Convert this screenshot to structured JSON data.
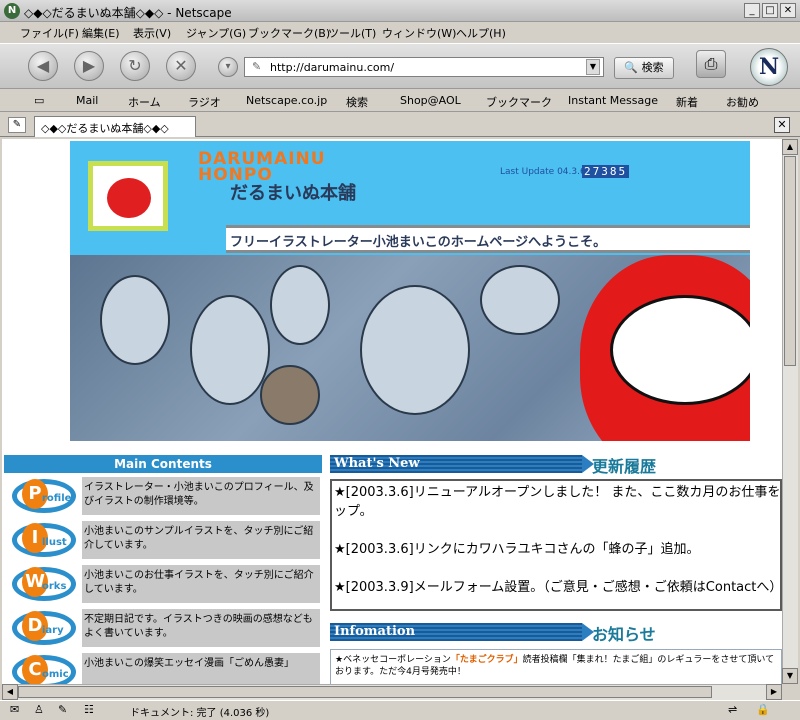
{
  "window": {
    "title": "◇◆◇だるまいぬ本舗◇◆◇ - Netscape",
    "min": "_",
    "max": "□",
    "close": "✕"
  },
  "menu": [
    "ファイル(F)",
    "編集(E)",
    "表示(V)",
    "ジャンプ(G)",
    "ブックマーク(B)",
    "ツール(T)",
    "ウィンドウ(W)",
    "ヘルプ(H)"
  ],
  "nav": {
    "url": "http://darumainu.com/",
    "search_label": "🔍 検索"
  },
  "personal_toolbar": [
    "Mail",
    "ホーム",
    "ラジオ",
    "Netscape.co.jp",
    "検索",
    "Shop@AOL",
    "ブックマーク",
    "Instant Message",
    "新着",
    "お勧め"
  ],
  "tab": {
    "label": "◇◆◇だるまいぬ本舗◇◆◇"
  },
  "status": {
    "text": "ドキュメント: 完了 (4.036 秒)"
  },
  "banner": {
    "logo_en": "DARUMAINU\nHONPO",
    "logo_jp": "だるまいぬ本舗",
    "last_update": "Last Update 04.3.6",
    "counter": "27385",
    "welcome": "フリーイラストレーター小池まいこのホームページへようこそ。"
  },
  "main_contents": {
    "heading": "Main Contents",
    "items": [
      {
        "initial": "P",
        "word": "rofile",
        "desc": "イラストレーター・小池まいこのプロフィール、及びイラストの制作環境等。"
      },
      {
        "initial": "I",
        "word": "llust",
        "desc": "小池まいこのサンプルイラストを、タッチ別にご紹介しています。"
      },
      {
        "initial": "W",
        "word": "orks",
        "desc": "小池まいこのお仕事イラストを、タッチ別にご紹介しています。"
      },
      {
        "initial": "D",
        "word": "iary",
        "desc": "不定期日記です。イラストつきの映画の感想などもよく書いています。"
      },
      {
        "initial": "C",
        "word": "omic",
        "desc": "小池まいこの爆笑エッセイ漫画「ごめん愚妻」"
      }
    ]
  },
  "whats_new": {
    "heading_en": "What's New",
    "heading_jp": "更新履歴",
    "text": "★[2003.3.6]リニューアルオープンしました！ また、ここ数カ月のお仕事をまとめてアップ。\n\n★[2003.3.6]リンクにカワハラユキコさんの「蜂の子」追加。\n\n★[2003.3.9]メールフォーム設置。（ご意見・ご感想・ご依頼はContactへ）"
  },
  "information": {
    "heading_en": "Infomation",
    "heading_jp": "お知らせ",
    "prefix": "★ベネッセコーポレーション",
    "highlight": "「たまごクラブ」",
    "rest": "読者投稿欄「集まれ！たまご組」のレギュラーをさせて頂いております。ただ今4月号発売中！"
  },
  "colors": {
    "accent_blue": "#2b8fcc",
    "banner_blue": "#4cc0f0",
    "orange": "#f08010",
    "daruma_red": "#e21a1a"
  }
}
